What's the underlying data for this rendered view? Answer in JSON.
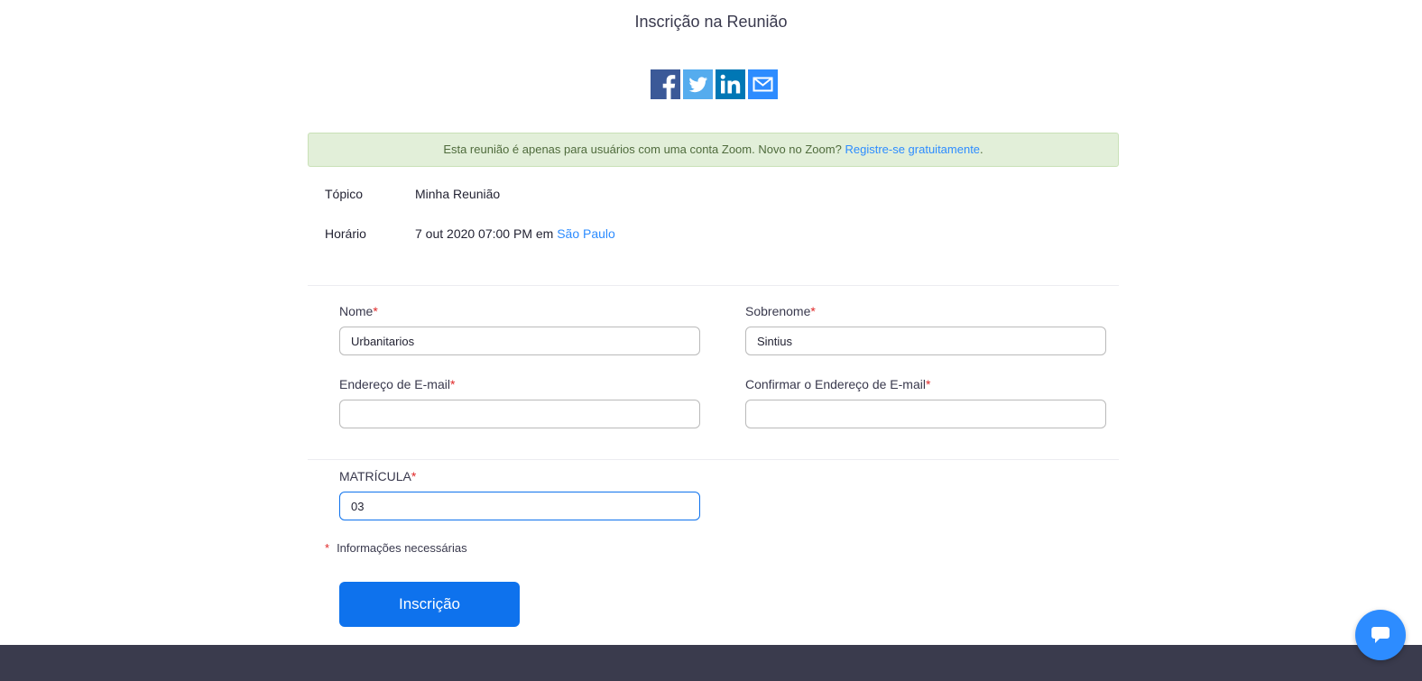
{
  "page": {
    "title": "Inscrição na Reunião"
  },
  "share": {
    "icons": [
      "facebook-icon",
      "twitter-icon",
      "linkedin-icon",
      "email-icon"
    ],
    "colors": {
      "facebook": "#3b5998",
      "twitter": "#55acee",
      "linkedin": "#0077b5",
      "email": "#2d8cff"
    }
  },
  "notice": {
    "text": "Esta reunião é apenas para usuários com uma conta Zoom. Novo no Zoom?",
    "link": "Registre-se gratuitamente",
    "suffix": "."
  },
  "meeting": {
    "topic_label": "Tópico",
    "topic_value": "Minha Reunião",
    "time_label": "Horário",
    "time_value": "7 out 2020 07:00 PM em",
    "timezone_link": "São Paulo"
  },
  "form": {
    "required_marker": "*",
    "first_name": {
      "label": "Nome",
      "value": "Urbanitarios"
    },
    "last_name": {
      "label": "Sobrenome",
      "value": "Sintius"
    },
    "email": {
      "label": "Endereço de E-mail",
      "value": ""
    },
    "confirm_email": {
      "label": "Confirmar o Endereço de E-mail",
      "value": ""
    },
    "matricula": {
      "label": "MATRÍCULA",
      "value": "03"
    },
    "required_note": "Informações necessárias",
    "submit_label": "Inscrição"
  },
  "colors": {
    "accent": "#0e72ed",
    "link": "#2d8cff",
    "required": "#e02828",
    "footer": "#3a3b4d"
  }
}
